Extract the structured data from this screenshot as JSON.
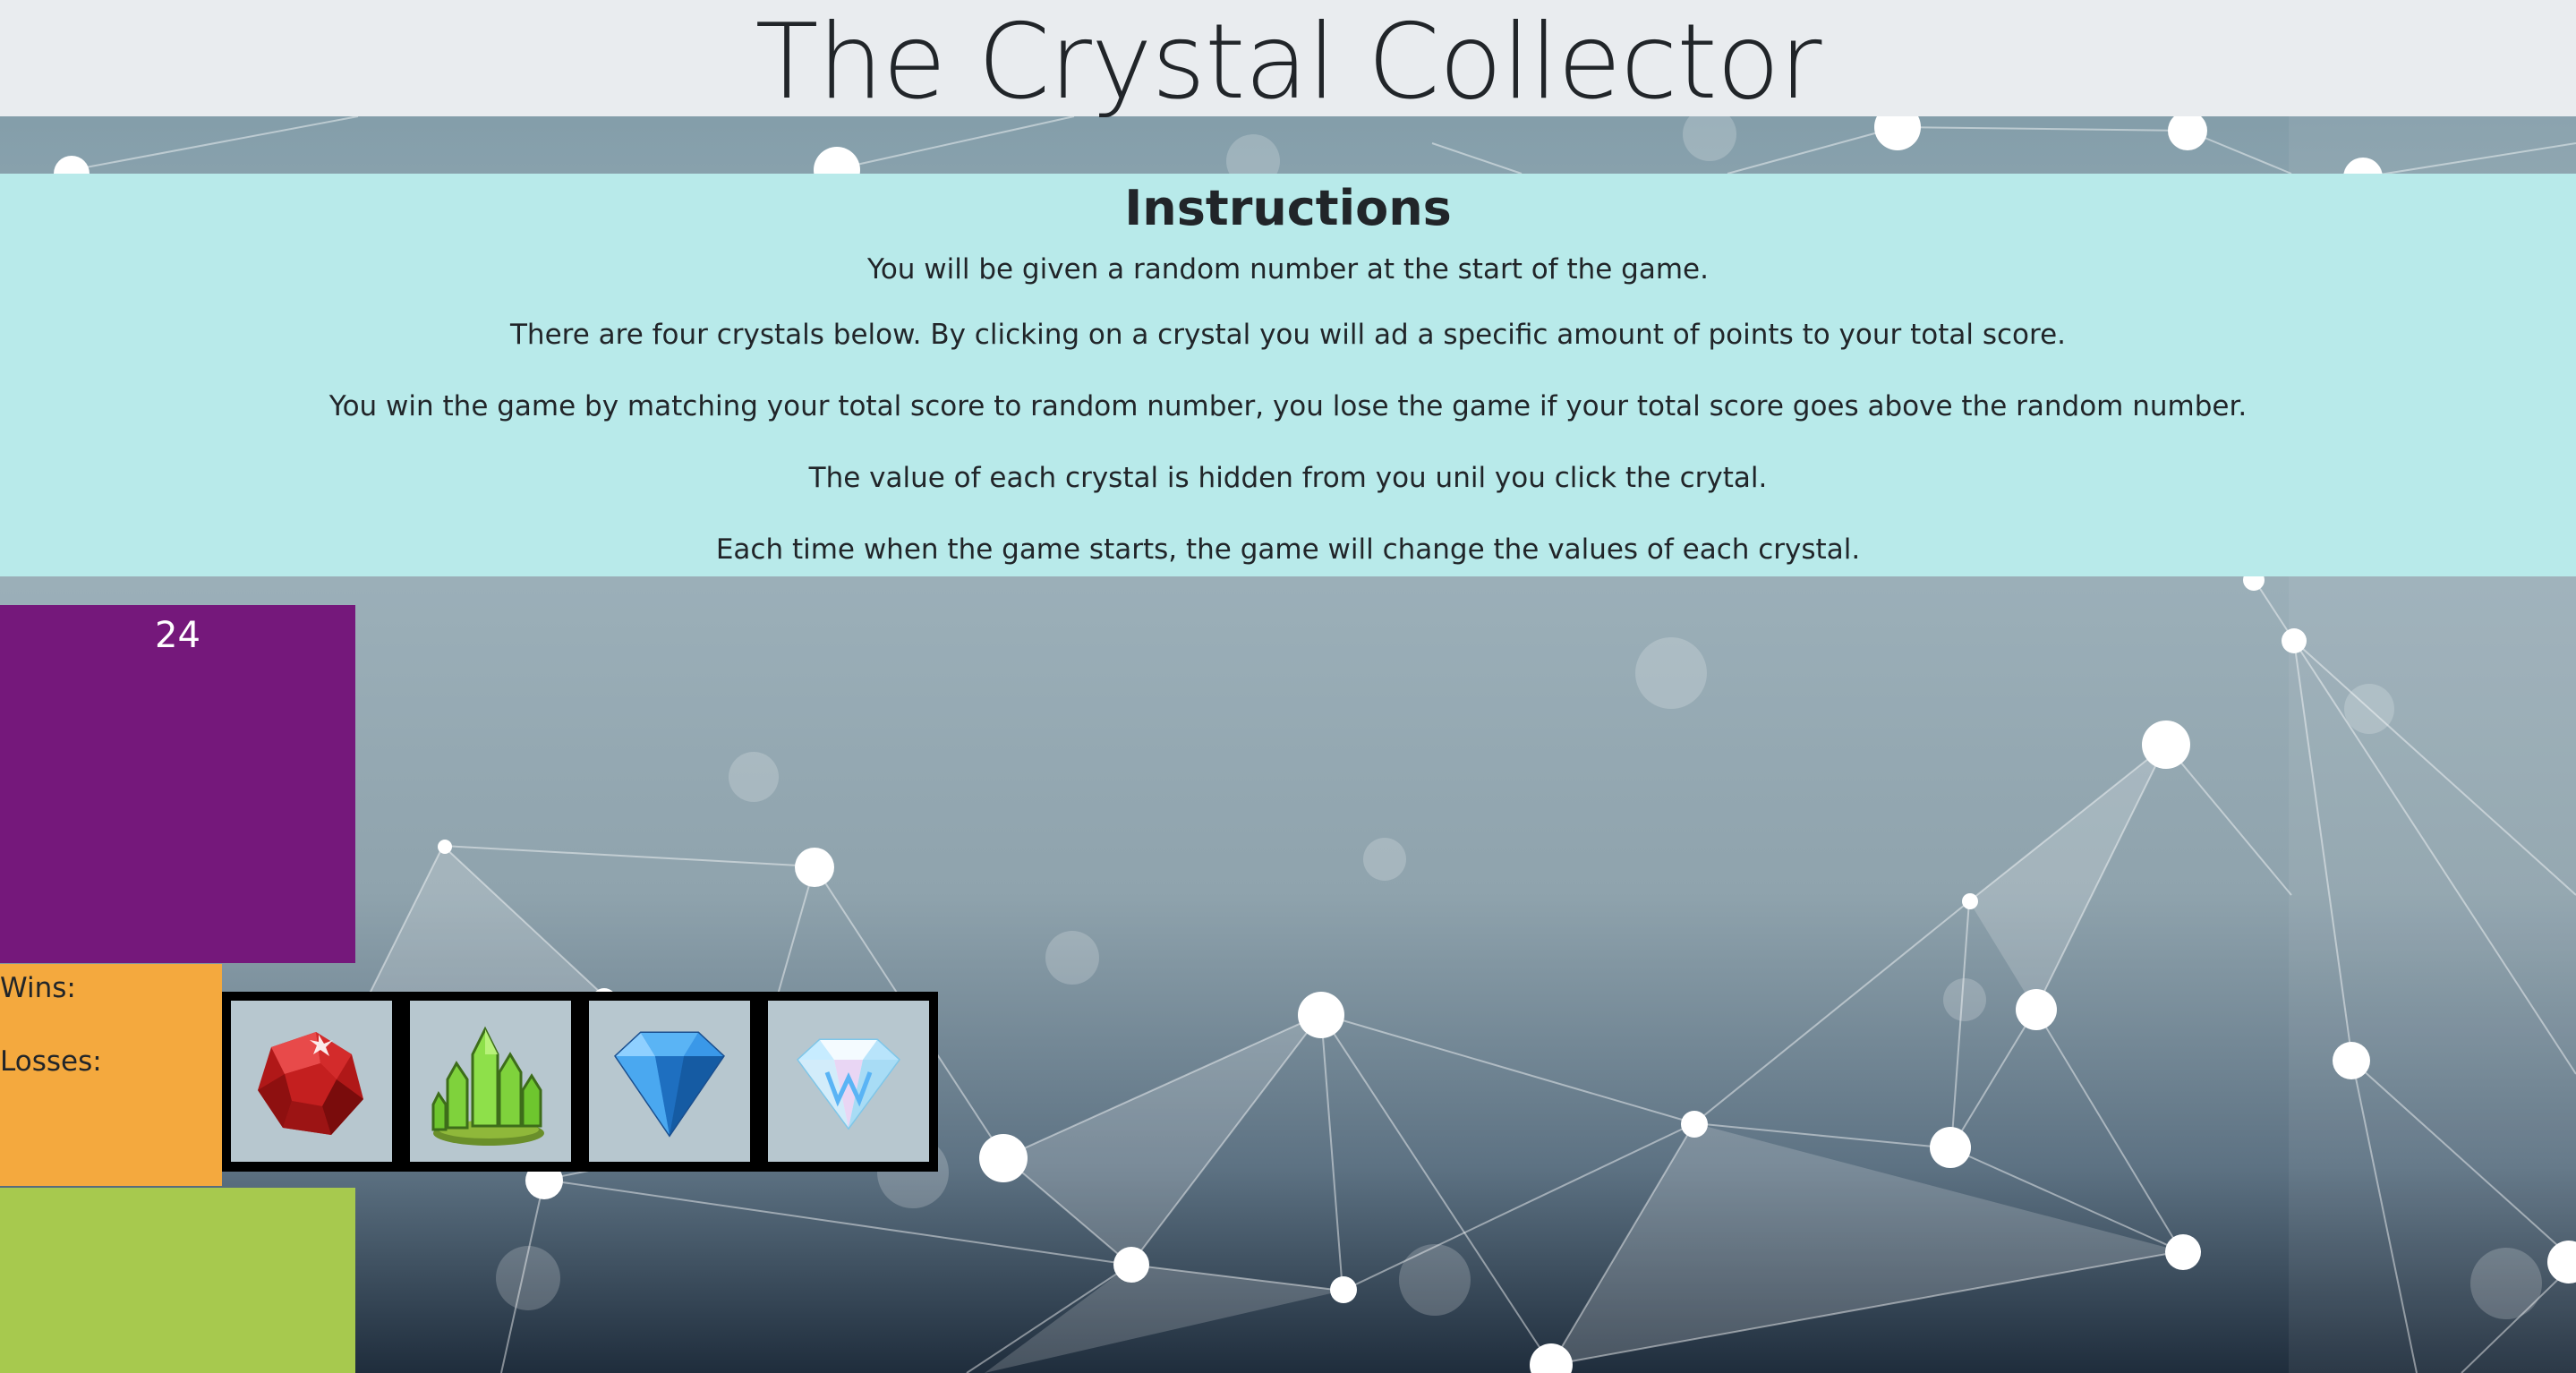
{
  "header": {
    "title": "The Crystal Collector"
  },
  "instructions": {
    "heading": "Instructions",
    "lines": [
      "You will be given a random number at the start of the game.",
      "There are four crystals below. By clicking on a crystal you will ad a specific amount of points to your total score.",
      "You win the game by matching your total score to random number, you lose the game if your total score goes above the random number.",
      "The value of each crystal is hidden from you unil you click the crytal.",
      "Each time when the game starts, the game will change the values of each crystal."
    ]
  },
  "game": {
    "random_number": "24",
    "wins_label": "Wins:",
    "losses_label": "Losses:",
    "crystals": [
      {
        "icon": "red-ruby-icon"
      },
      {
        "icon": "green-crystal-cluster-icon"
      },
      {
        "icon": "blue-diamond-icon"
      },
      {
        "icon": "white-diamond-icon"
      }
    ]
  },
  "colors": {
    "header_bg": "#e9ecef",
    "instructions_bg": "#b8eaea",
    "target_bg": "#75187b",
    "score_bg": "#f4a93e",
    "total_bg": "#a7c94e"
  }
}
